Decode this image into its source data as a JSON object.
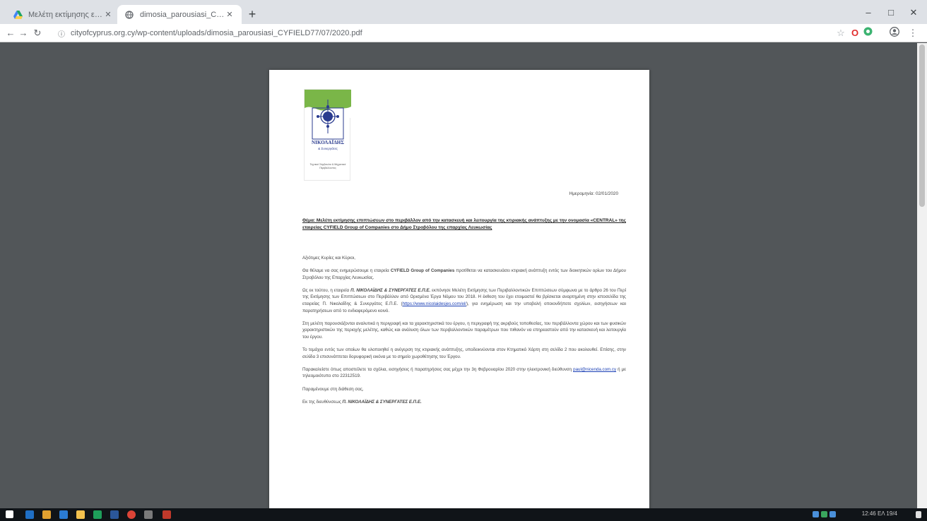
{
  "browser": {
    "tabs": [
      {
        "title": "Μελέτη εκτίμησης επιπτώσεων...",
        "favicon": "google-drive-icon"
      },
      {
        "title": "dimosia_parousiasi_CYFIELD77...",
        "favicon": "globe-icon"
      }
    ],
    "new_tab": "+",
    "url": "cityofcyprus.org.cy/wp-content/uploads/dimosia_parousiasi_CYFIELD77/07/2020.pdf",
    "window_controls": {
      "minimize": "–",
      "maximize": "□",
      "close": "✕"
    }
  },
  "document": {
    "logo": {
      "brand_name": "ΝΙΚΟΛΑΪΔΗΣ",
      "brand_sub": "& Συνεργάτες",
      "tagline": "Τεχνικοί Σύμβουλοι & Μηχανικοί Περιβάλλοντος",
      "colors": {
        "green": "#7ab648",
        "blue": "#2a3b8f"
      }
    },
    "date": "Ημερομηνία: 02/01/2020",
    "subject": "Θέμα: Μελέτη εκτίμησης επιπτώσεων στο περιβάλλον από την κατασκευή και λειτουργία της κτιριακής ανάπτυξης με την ονομασία «CENTRAL» της εταιρείας CYFIELD Group of Companies στο Δήμο Στροβόλου της επαρχίας Λευκωσίας",
    "paragraphs": [
      "Αξιότιμες Κυρίες και Κύριοι,",
      "Θα θέλαμε να σας ενημερώσουμε η εταιρεία <b>CYFIELD Group of Companies</b> προτίθεται να κατασκευάσει κτιριακή ανάπτυξη εντός των διοικητικών ορίων του Δήμου Στροβόλου της Επαρχίας Λευκωσίας.",
      "Ως εκ τούτου, η εταιρεία <b><i>Π. ΝΙΚΟΛΑΪΔΗΣ &amp; ΣΥΝΕΡΓΑΤΕΣ Ε.Π.Ε.</i></b> εκπόνησε Μελέτη Εκτίμησης των Περιβαλλοντικών Επιπτώσεων σύμφωνα με το άρθρο 26 του Περί της Εκτίμησης των Επιπτώσεων στο Περιβάλλον από Ορισμένα Έργα Νόμου του 2018. Η έκθεση του έχει ετοιμαστεί θα βρίσκεται αναρτημένη στην ιστοσελίδα της εταιρείας Π. Νικολαΐδης &amp; Συνεργάτες Ε.Π.Ε. (<a>https://www.nicolaidesjes.com/el/</a>), για ενημέρωση και την υποβολή οποιονδήποτε σχολίων, εισηγήσεων και παρατηρήσεων από το ενδιαφερόμενο κοινό.",
      "Στη μελέτη παρουσιάζονται αναλυτικά η περιγραφή και τα χαρακτηριστικά του έργου, η περιγραφή της ακριβούς τοποθεσίας, του περιβάλλοντα χώρου και των φυσικών χαρακτηριστικών της περιοχής μελέτης, καθώς και ανάλυση όλων των περιβαλλοντικών παραμέτρων που πιθανόν να επηρεαστούν από την κατασκευή και λειτουργία του έργου.",
      "Το τεμάχιο εντός των οποίων θα υλοποιηθεί η ανέγερση της κτιριακής ανάπτυξης, υποδεικνύονται στον Κτηματικό Χάρτη στη σελίδα 2 που ακολουθεί. Επίσης, στην σελίδα 3 επισυνάπτεται δορυφορική εικόνα με το σημείο χωροθέτησης του Έργου.",
      "Παρακαλείστε όπως αποστείλετε τα σχόλια, εισηγήσεις ή παρατηρήσεις σας μέχρι την 3η Φεβρουαρίου 2020 στην ηλεκτρονική διεύθυνση <a>paul@nicenda.com.cy</a> ή με τηλεομοιότυπο στο 22312519.",
      "Παραμένουμε στη διάθεση σας,",
      "Εκ της διευθύνσεως <b><i>Π. ΝΙΚΟΛΑΪΔΗΣ &amp; ΣΥΝΕΡΓΑΤΕΣ Ε.Π.Ε.</i></b>"
    ]
  },
  "taskbar": {
    "clock": "12:46  ΕΛ  19/4"
  }
}
